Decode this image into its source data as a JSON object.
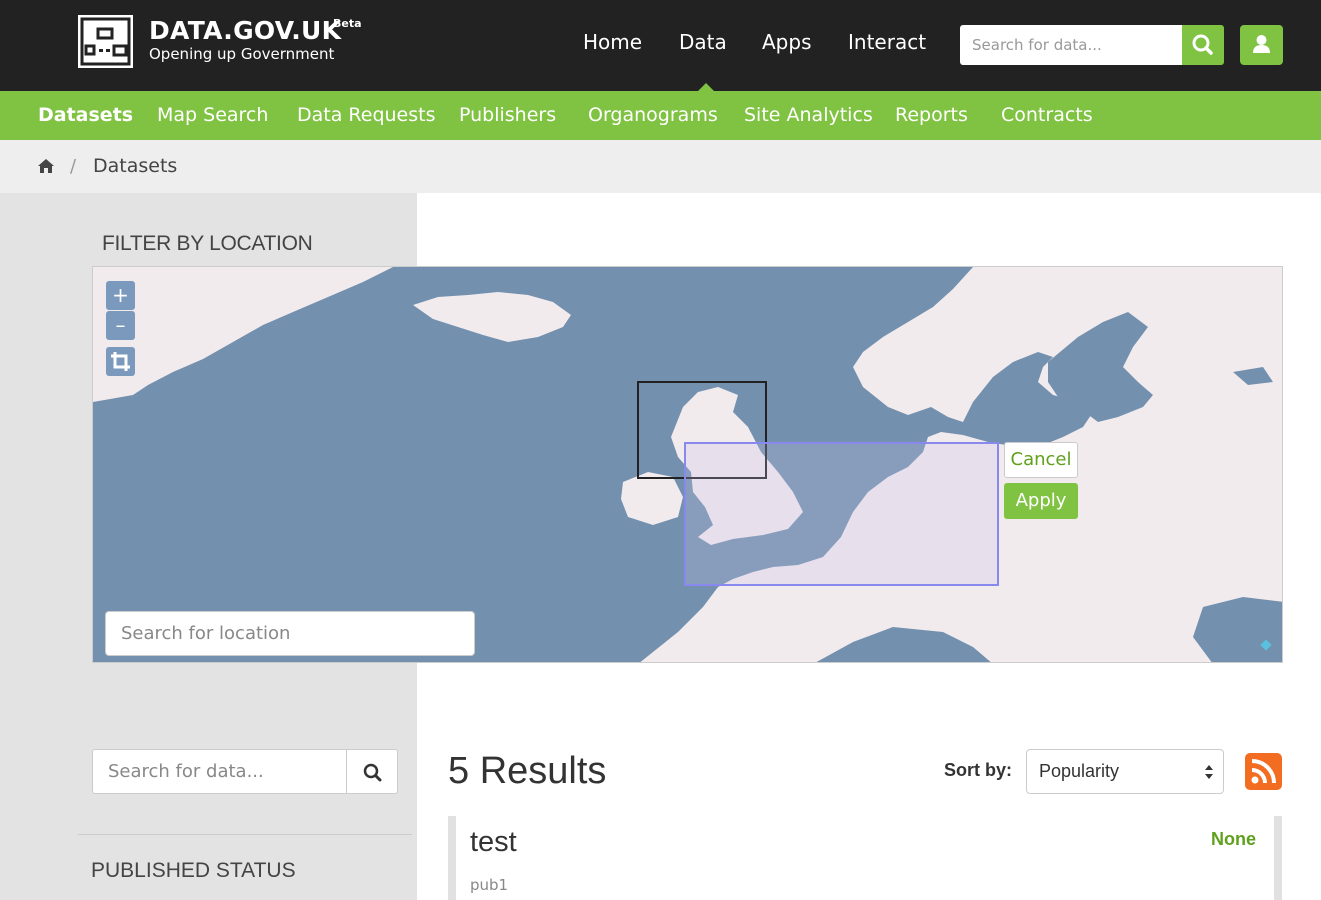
{
  "header": {
    "brand": "DATA.GOV.UK",
    "beta": "Beta",
    "tagline": "Opening up Government",
    "nav": [
      "Home",
      "Data",
      "Apps",
      "Interact"
    ],
    "active_nav": "Data",
    "search_placeholder": "Search for data..."
  },
  "subnav": {
    "items": [
      "Datasets",
      "Map Search",
      "Data Requests",
      "Publishers",
      "Organograms",
      "Site Analytics",
      "Reports",
      "Contracts"
    ],
    "active": "Datasets"
  },
  "breadcrumb": {
    "items": [
      "Datasets"
    ]
  },
  "sidebar": {
    "filter_title": "FILTER BY LOCATION",
    "search_placeholder": "Search for data...",
    "published_status_title": "PUBLISHED STATUS"
  },
  "map": {
    "zoom_in": "+",
    "zoom_out": "–",
    "location_placeholder": "Search for location",
    "cancel_label": "Cancel",
    "apply_label": "Apply",
    "colors": {
      "sea": "#7390ae",
      "land": "#f2ebee",
      "selection": "#8888ee"
    }
  },
  "results": {
    "count_label": "5 Results",
    "sort_label": "Sort by:",
    "sort_value": "Popularity",
    "items": [
      {
        "title": "test",
        "publisher": "pub1",
        "status": "None"
      }
    ]
  },
  "colors": {
    "brand_green": "#80c343",
    "topbar": "#222222",
    "rss_orange": "#f26c21"
  }
}
